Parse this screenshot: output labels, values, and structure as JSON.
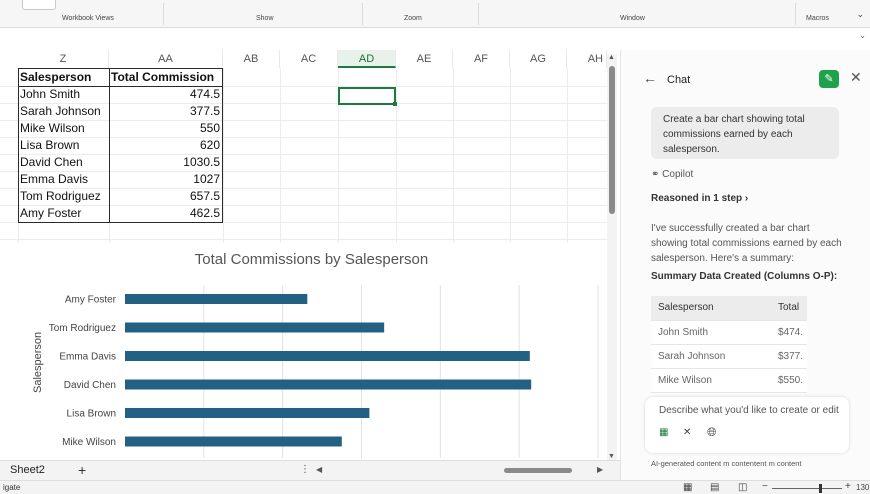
{
  "ribbon": {
    "groups": [
      "Workbook Views",
      "Show",
      "Zoom",
      "Window",
      "Macros"
    ]
  },
  "grid": {
    "columns": [
      "Z",
      "AA",
      "AB",
      "AC",
      "AD",
      "AE",
      "AF",
      "AG",
      "AH"
    ],
    "selected_column": "AD",
    "header": [
      "Salesperson",
      "Total Commission"
    ],
    "rows": [
      [
        "John Smith",
        "474.5"
      ],
      [
        "Sarah Johnson",
        "377.5"
      ],
      [
        "Mike Wilson",
        "550"
      ],
      [
        "Lisa Brown",
        "620"
      ],
      [
        "David Chen",
        "1030.5"
      ],
      [
        "Emma Davis",
        "1027"
      ],
      [
        "Tom Rodriguez",
        "657.5"
      ],
      [
        "Amy Foster",
        "462.5"
      ]
    ]
  },
  "chart_data": {
    "type": "bar",
    "orientation": "horizontal",
    "title": "Total Commissions by Salesperson",
    "ylabel": "Salesperson",
    "categories": [
      "Amy Foster",
      "Tom Rodriguez",
      "Emma Davis",
      "David Chen",
      "Lisa Brown",
      "Mike Wilson"
    ],
    "values": [
      462.5,
      657.5,
      1027,
      1030.5,
      620,
      550
    ],
    "xlim": [
      0,
      1200
    ],
    "grid": true,
    "bar_color": "#236184"
  },
  "sheet": {
    "tab": "Sheet2",
    "add_label": "+"
  },
  "status": {
    "text": "igate",
    "zoom": "130"
  },
  "chat": {
    "title": "Chat",
    "user_message": "Create a bar chart showing total commissions earned by each salesperson.",
    "assistant_name": "Copilot",
    "reasoned": "Reasoned in 1 step",
    "response": "I've successfully created a bar chart showing total commissions earned by each salesperson. Here's a summary:",
    "summary_header": "Summary Data Created (Columns O-P):",
    "table_headers": [
      "Salesperson",
      "Total"
    ],
    "table_rows": [
      [
        "John Smith",
        "$474."
      ],
      [
        "Sarah Johnson",
        "$377."
      ],
      [
        "Mike Wilson",
        "$550."
      ]
    ],
    "input_placeholder": "Describe what you'd like to create or edit",
    "disclaimer": "AI-generated content m contentent m content"
  },
  "colors": {
    "accent": "#1e7a3e",
    "bar": "#236184"
  }
}
